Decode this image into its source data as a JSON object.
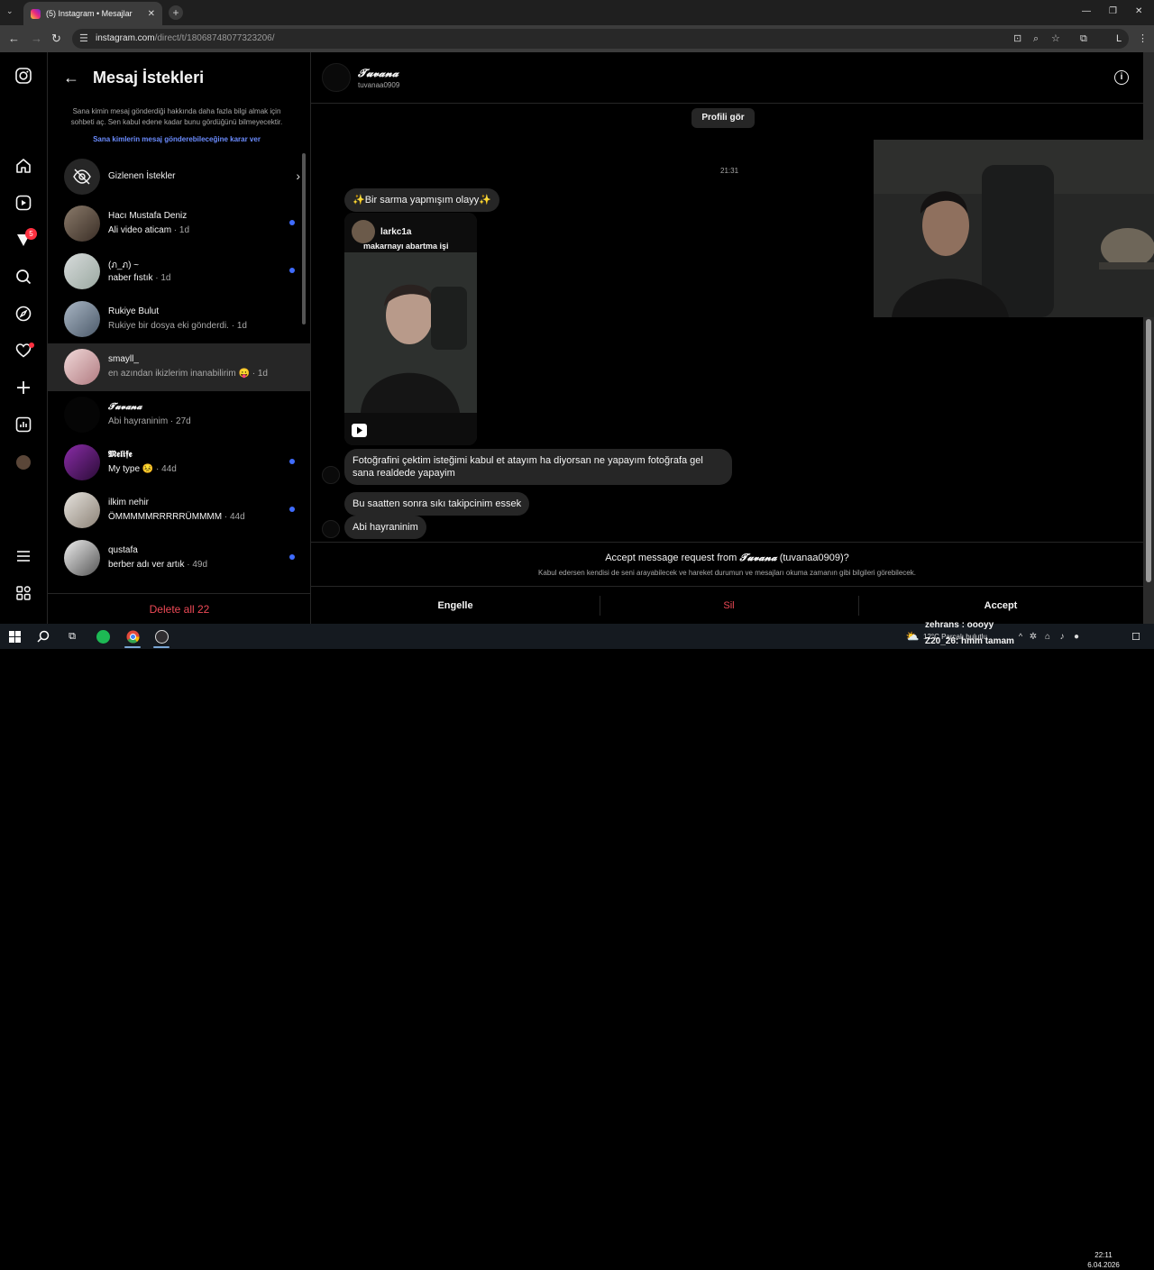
{
  "browser": {
    "tab_title": "(5) Instagram • Mesajlar",
    "tab_close": "✕",
    "new_tab": "+",
    "url_domain": "instagram.com",
    "url_path": "/direct/t/18068748077323206/"
  },
  "sidebar": {
    "notification_count": "5"
  },
  "requests": {
    "title": "Mesaj İstekleri",
    "info": "Sana kimin mesaj gönderdiği hakkında daha fazla bilgi almak için sohbeti aç. Sen kabul edene kadar bunu gördüğünü bilmeyecektir.",
    "link": "Sana kimlerin mesaj gönderebileceğine karar ver",
    "hidden_label": "Gizlenen İstekler",
    "items": [
      {
        "name": "Hacı Mustafa Deniz",
        "preview": "Ali video aticam",
        "time": " · 1d",
        "unread": true
      },
      {
        "name": "(ภ_ภ) ~",
        "preview": "naber fıstık",
        "time": " · 1d",
        "unread": true
      },
      {
        "name": "Rukiye Bulut",
        "preview": "Rukiye bir dosya eki gönderdi.",
        "time": " · 1d",
        "unread": false
      },
      {
        "name": "smayll_",
        "preview": "en azından ikizlerim inanabilirim 😛",
        "time": " · 1d",
        "unread": false
      },
      {
        "name": "𝓣𝓾𝓿𝓪𝓷𝓪",
        "preview": "Abi hayraninim",
        "time": " · 27d",
        "unread": false
      },
      {
        "name": "𝕸𝖊𝖑𝖎𝖋𝖊",
        "preview": "My type 😣",
        "time": " · 44d",
        "unread": true
      },
      {
        "name": "ilkim nehir",
        "preview": "ÖMMMMMRRRRRÜMMMM",
        "time": " · 44d",
        "unread": true
      },
      {
        "name": "qustafa",
        "preview": "berber adı ver artık",
        "time": " · 49d",
        "unread": true
      }
    ],
    "delete_all": "Delete all 22"
  },
  "chat": {
    "name": "𝓣𝓾𝓿𝓪𝓷𝓪",
    "username": "tuvanaa0909",
    "profile_button": "Profili gör",
    "time": "21:31",
    "messages": {
      "m1": "✨Bir sarma yapmışım olayy✨",
      "share_user": "larkc1a",
      "share_caption": "makarnayı abartma işi",
      "m2": "Fotoğrafini çektim isteğimi kabul et atayım ha diyorsan ne yapayım fotoğrafa gel sana realdede yapayim",
      "m3": "Bu saatten sonra sıkı takipcinim essek",
      "m4": "Abi hayraninim"
    },
    "accept_prefix": "Accept message request from ",
    "accept_name": "𝓣𝓾𝓿𝓪𝓷𝓪",
    "accept_suffix": " (tuvanaa0909)?",
    "accept_note": "Kabul edersen kendisi de seni arayabilecek ve hareket durumun ve mesajları okuma zamanın gibi bilgileri görebilecek.",
    "block": "Engelle",
    "delete": "Sil",
    "accept": "Accept"
  },
  "taskbar": {
    "chat1": "zehrans : oooyy",
    "weather": "12°C  Parçalı bulutlu",
    "chat2": "Z20_26: hmm tamam",
    "time": "22:11",
    "date": "6.04.2026"
  },
  "colors": {
    "link_blue": "#6b8cff",
    "unread_dot": "#3f6cff",
    "danger_red": "#ed4956",
    "bubble_gray": "#262626"
  }
}
